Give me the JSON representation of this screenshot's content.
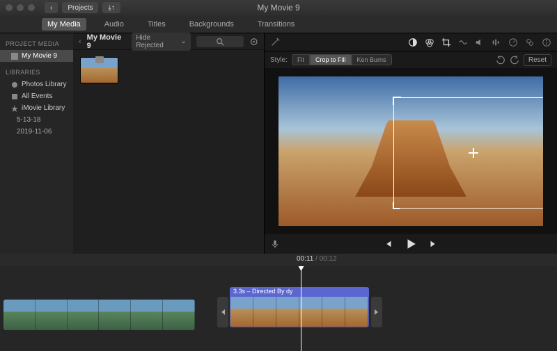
{
  "window": {
    "title": "My Movie 9"
  },
  "toolbar": {
    "back": "‹",
    "projects": "Projects",
    "import": "⤓↑"
  },
  "tabs": [
    "My Media",
    "Audio",
    "Titles",
    "Backgrounds",
    "Transitions"
  ],
  "active_tab": 0,
  "sidebar": {
    "section1": "PROJECT MEDIA",
    "project": "My Movie 9",
    "section2": "LIBRARIES",
    "items": [
      {
        "label": "Photos Library",
        "icon": "photos"
      },
      {
        "label": "All Events",
        "icon": "events"
      },
      {
        "label": "iMovie Library",
        "icon": "library",
        "expanded": true,
        "children": [
          "5-13-18",
          "2019-11-06"
        ]
      }
    ]
  },
  "browser": {
    "title": "My Movie 9",
    "filter": "Hide Rejected"
  },
  "styleRow": {
    "label": "Style:",
    "options": [
      "Fit",
      "Crop to Fill",
      "Ken Burns"
    ],
    "active": 1,
    "reset": "Reset"
  },
  "timecode": {
    "current": "00:11",
    "total": "00:12"
  },
  "clipB_header": "3.3s – Directed By dy"
}
